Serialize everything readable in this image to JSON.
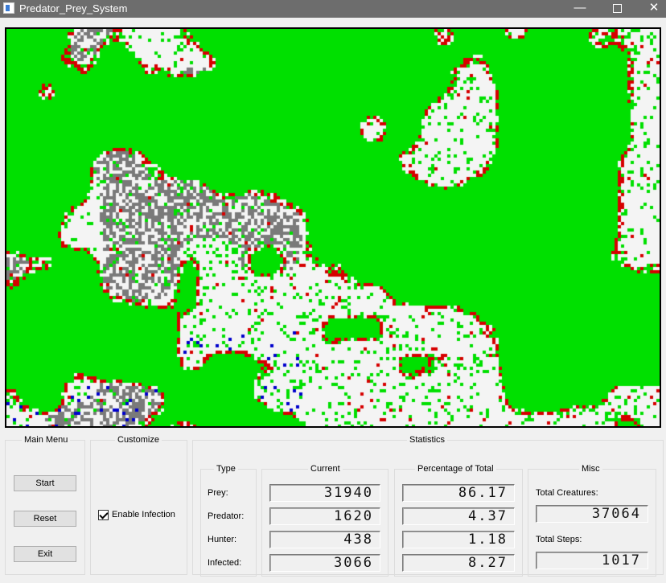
{
  "window": {
    "title": "Predator_Prey_System",
    "minimize_icon": "minimize-icon",
    "maximize_icon": "maximize-icon",
    "close_icon": "close-icon",
    "minimize_glyph": "—",
    "close_glyph": "✕"
  },
  "simulation": {
    "colors": {
      "empty": "#f4f4f4",
      "prey": "#00e000",
      "predator": "#d60000",
      "hunter": "#0000cc",
      "infected": "#7a7a7a"
    }
  },
  "main_menu": {
    "title": "Main Menu",
    "start_label": "Start",
    "reset_label": "Reset",
    "exit_label": "Exit"
  },
  "customize": {
    "title": "Customize",
    "infection_label": "Enable Infection",
    "infection_checked": true
  },
  "statistics": {
    "title": "Statistics",
    "type_title": "Type",
    "current_title": "Current",
    "percent_title": "Percentage of Total",
    "misc_title": "Misc",
    "rows": [
      {
        "label": "Prey:",
        "current": "31940",
        "percent": "86.17"
      },
      {
        "label": "Predator:",
        "current": "1620",
        "percent": "4.37"
      },
      {
        "label": "Hunter:",
        "current": "438",
        "percent": "1.18"
      },
      {
        "label": "Infected:",
        "current": "3066",
        "percent": "8.27"
      }
    ],
    "misc": {
      "total_creatures_label": "Total Creatures:",
      "total_creatures_value": "37064",
      "total_steps_label": "Total Steps:",
      "total_steps_value": "1017"
    }
  }
}
